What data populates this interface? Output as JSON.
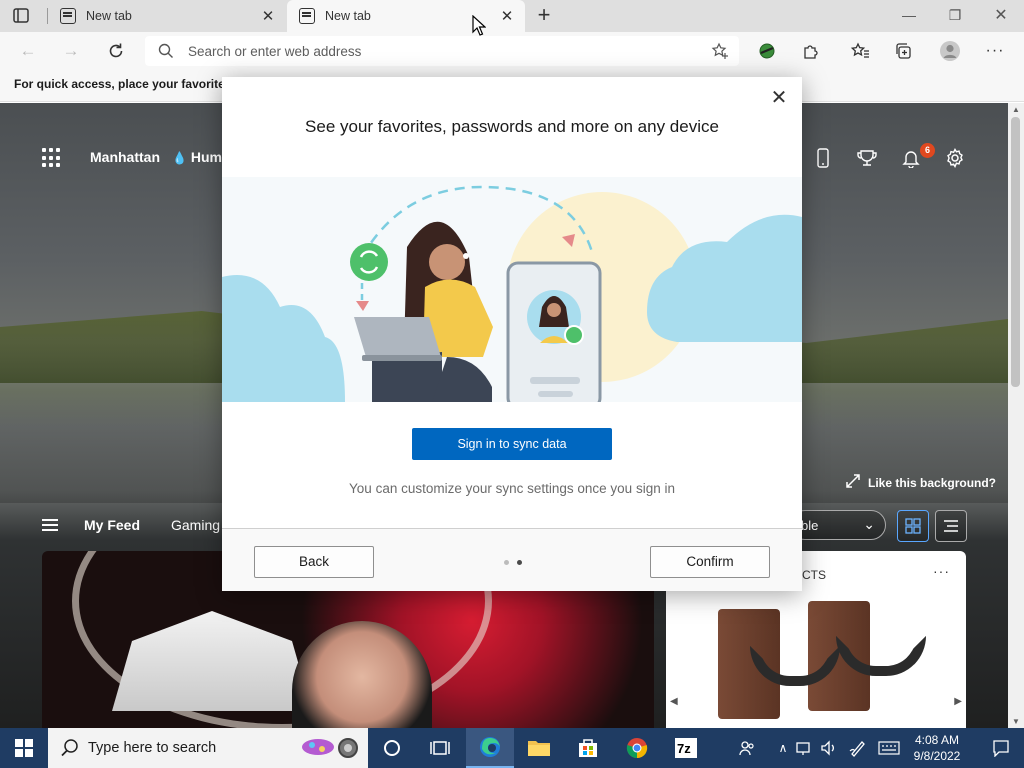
{
  "browser": {
    "tabs": [
      {
        "title": "New tab",
        "active": false
      },
      {
        "title": "New tab",
        "active": true
      }
    ],
    "address_placeholder": "Search or enter web address",
    "favorites_hint": "For quick access, place your favorites h"
  },
  "ntp": {
    "location": "Manhattan",
    "weather": "Hum",
    "notification_count": "6",
    "like_background": "Like this background?",
    "feed_tabs": [
      "My Feed",
      "Gaming"
    ],
    "layout_select": "ble",
    "product_card_label": "CTS",
    "product_card_more": "···"
  },
  "modal": {
    "title": "See your favorites, passwords and more on any device",
    "sync_button": "Sign in to sync data",
    "note": "You can customize your sync settings once you sign in",
    "back_button": "Back",
    "confirm_button": "Confirm",
    "page_dots": [
      false,
      true
    ]
  },
  "taskbar": {
    "search_placeholder": "Type here to search",
    "time": "4:08 AM",
    "date": "9/8/2022"
  },
  "colors": {
    "accent": "#0067c0",
    "taskbar": "#1f3c63",
    "badge": "#e0481f"
  }
}
